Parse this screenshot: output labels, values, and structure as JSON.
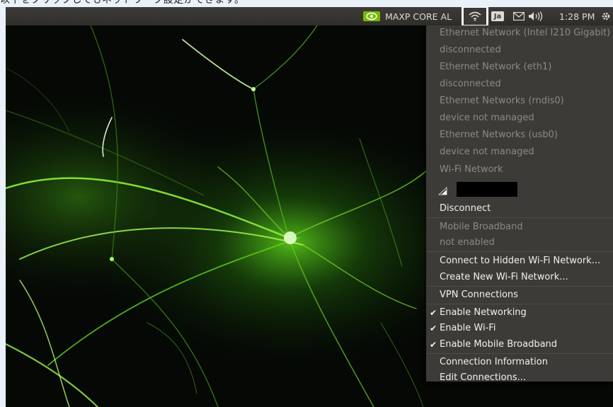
{
  "caption": {
    "text": "以下をクリックしてもネットワーク設定ができます。"
  },
  "topbar": {
    "network_label": "MAXP CORE AL",
    "input_method": "Ja",
    "clock": "1:28 PM"
  },
  "menu": {
    "items": [
      {
        "label": "Ethernet Network (Intel I210 Gigabit)",
        "enabled": false
      },
      {
        "label": "disconnected",
        "enabled": false
      },
      {
        "label": "Ethernet Network (eth1)",
        "enabled": false
      },
      {
        "label": "disconnected",
        "enabled": false
      },
      {
        "label": "Ethernet Networks (rndis0)",
        "enabled": false
      },
      {
        "label": "device not managed",
        "enabled": false
      },
      {
        "label": "Ethernet Networks (usb0)",
        "enabled": false
      },
      {
        "label": "device not managed",
        "enabled": false
      },
      {
        "label": "Wi-Fi Network",
        "enabled": false
      },
      {
        "label": "Disconnect",
        "enabled": true
      },
      {
        "label": "Mobile Broadband",
        "enabled": false
      },
      {
        "label": "not enabled",
        "enabled": false
      },
      {
        "label": "Connect to Hidden Wi-Fi Network...",
        "enabled": true
      },
      {
        "label": "Create New Wi-Fi Network...",
        "enabled": true
      },
      {
        "label": "VPN Connections",
        "enabled": true
      },
      {
        "label": "Enable Networking",
        "enabled": true,
        "checked": true
      },
      {
        "label": "Enable Wi-Fi",
        "enabled": true,
        "checked": true
      },
      {
        "label": "Enable Mobile Broadband",
        "enabled": true,
        "checked": true
      },
      {
        "label": "Connection Information",
        "enabled": true
      },
      {
        "label": "Edit Connections...",
        "enabled": true
      }
    ],
    "check_glyph": "✔"
  },
  "colors": {
    "panel": "#3c3b37",
    "enabled_text": "#f2f1ef",
    "disabled_text": "#8d8a83",
    "highlight_border": "#fefefe",
    "nvidia_green": "#76b900"
  },
  "icons": [
    "nvidia-icon",
    "wifi-icon",
    "mail-icon",
    "volume-icon",
    "gear-icon",
    "wifi-signal-icon"
  ]
}
